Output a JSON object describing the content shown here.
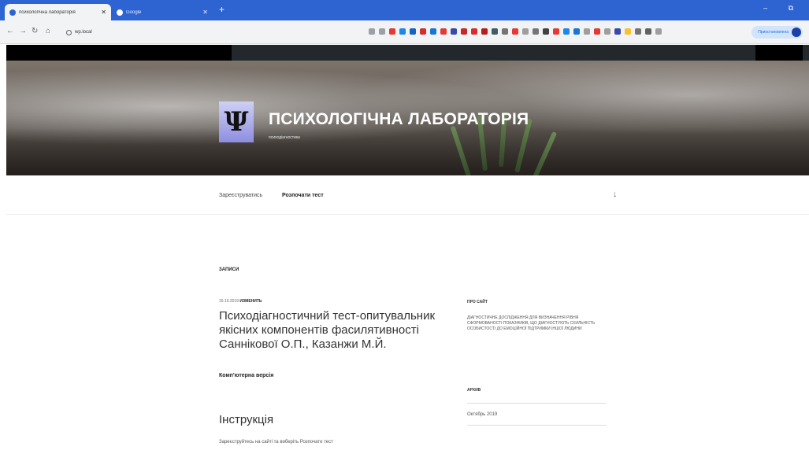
{
  "browser": {
    "tabs": [
      {
        "title": "психологічна лабораторія"
      },
      {
        "title": "Google"
      }
    ],
    "new_tab": "+",
    "window_controls": "– ⧉",
    "address": "wp.local",
    "profile_label": "Приостановлена"
  },
  "site": {
    "title": "ПСИХОЛОГІЧНА ЛАБОРАТОРІЯ",
    "description": "психодіагностика",
    "logo_glyph": "Ψ"
  },
  "menu": {
    "items": [
      {
        "label": "Зареєструватись"
      },
      {
        "label": "Розпочати тест"
      }
    ]
  },
  "content": {
    "section_label": "ЗАПИСИ",
    "post_date": "15.10.2019",
    "post_edit": "ИЗМЕНИТЬ",
    "post_title": "Психодіагностичний тест-опитувальник якісних компонентів фасилятивності Саннікової О.П., Казанжи М.Й.",
    "post_subtitle": "Комп'ютерна версія",
    "instruction_heading": "Інструкція",
    "instruction_text": "Зареєструйтесь на сайті та виберіть Розпочати тест"
  },
  "sidebar": {
    "about_title": "ПРО САЙТ",
    "about_text": "ДІАГНОСТИЧНЕ ДОСЛІДЖЕННЯ ДЛЯ ВИЗНАЧЕННЯ РІВНЯ СФОРМОВАНОСТІ ПОКАЗНИКІВ, ЩО ДІАГНОСТУЮТЬ СХИЛЬНІСТЬ ОСОБИСТОСТІ ДО ЕМОЦІЙНОЇ ПІДТРИМКИ ІНШОЇ ЛЮДИНИ",
    "archive_title": "АРХИВ",
    "archive_link": "Октябрь 2019"
  },
  "colors": {
    "tabbar": "#2e63d2",
    "adminbar": "#23282d"
  }
}
